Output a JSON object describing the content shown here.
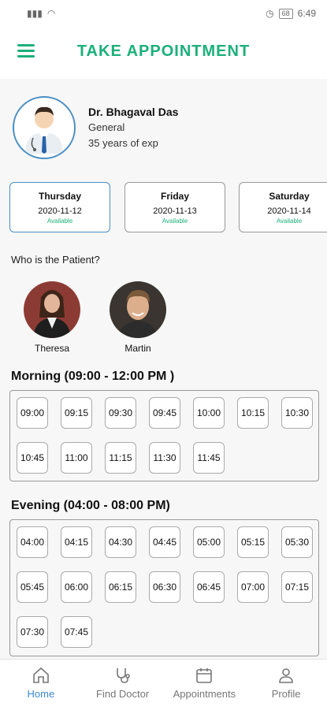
{
  "status_bar": {
    "time": "6:49",
    "battery": "68"
  },
  "header": {
    "title": "TAKE APPOINTMENT"
  },
  "doctor": {
    "name": "Dr. Bhagaval Das",
    "specialty": "General",
    "experience": "35 years of exp"
  },
  "days": [
    {
      "day": "Thursday",
      "date": "2020-11-12",
      "status": "Available"
    },
    {
      "day": "Friday",
      "date": "2020-11-13",
      "status": "Available"
    },
    {
      "day": "Saturday",
      "date": "2020-11-14",
      "status": "Available"
    }
  ],
  "patients": {
    "question": "Who is the Patient?",
    "list": [
      {
        "name": "Theresa"
      },
      {
        "name": "Martin"
      }
    ]
  },
  "morning": {
    "title": "Morning (09:00 - 12:00 PM )",
    "slots": [
      "09:00",
      "09:15",
      "09:30",
      "09:45",
      "10:00",
      "10:15",
      "10:30",
      "10:45",
      "11:00",
      "11:15",
      "11:30",
      "11:45"
    ]
  },
  "evening": {
    "title": "Evening (04:00 - 08:00 PM)",
    "slots": [
      "04:00",
      "04:15",
      "04:30",
      "04:45",
      "05:00",
      "05:15",
      "05:30",
      "05:45",
      "06:00",
      "06:15",
      "06:30",
      "06:45",
      "07:00",
      "07:15",
      "07:30",
      "07:45"
    ]
  },
  "nav": [
    {
      "label": "Home",
      "icon": "home-icon"
    },
    {
      "label": "Find Doctor",
      "icon": "stethoscope-icon"
    },
    {
      "label": "Appointments",
      "icon": "calendar-icon"
    },
    {
      "label": "Profile",
      "icon": "user-icon"
    }
  ],
  "colors": {
    "accent": "#1bb07a",
    "selected": "#4a8fc4",
    "nav_active": "#3a8ad1"
  }
}
